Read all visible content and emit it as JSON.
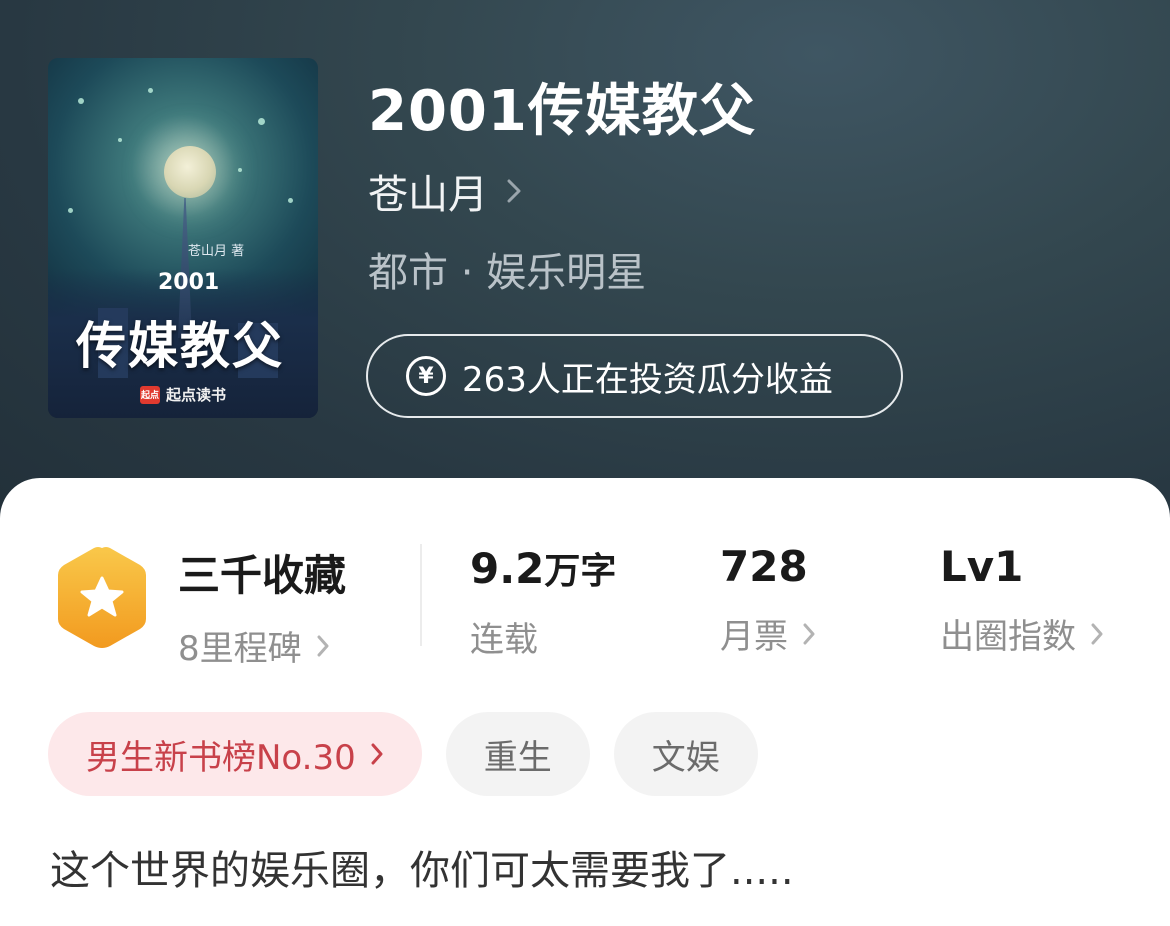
{
  "book": {
    "title": "2001传媒教父",
    "author": "苍山月",
    "genre": "都市 · 娱乐明星",
    "invest_text": "263人正在投资瓜分收益",
    "description": "这个世界的娱乐圈，你们可太需要我了....."
  },
  "cover": {
    "author": "苍山月 著",
    "year": "2001",
    "title": "传媒教父",
    "publisher": "起点读书",
    "publisher_logo": "起点"
  },
  "stats": {
    "collection": {
      "value": "三千收藏",
      "label": "8里程碑"
    },
    "words": {
      "value": "9.2",
      "unit": "万字",
      "label": "连载"
    },
    "monthly_ticket": {
      "value": "728",
      "label": "月票"
    },
    "influence": {
      "value": "Lv1",
      "label": "出圈指数"
    }
  },
  "tags": {
    "rank": "男生新书榜No.30",
    "items": [
      "重生",
      "文娱"
    ]
  },
  "colors": {
    "accent_red": "#c8414a",
    "badge_orange": "#f5a623",
    "header_bg": "#2b3a47"
  },
  "icons": {
    "badge": "star-hexagon-icon",
    "yen": "yen-coin-icon",
    "chevron": "chevron-right-icon"
  }
}
